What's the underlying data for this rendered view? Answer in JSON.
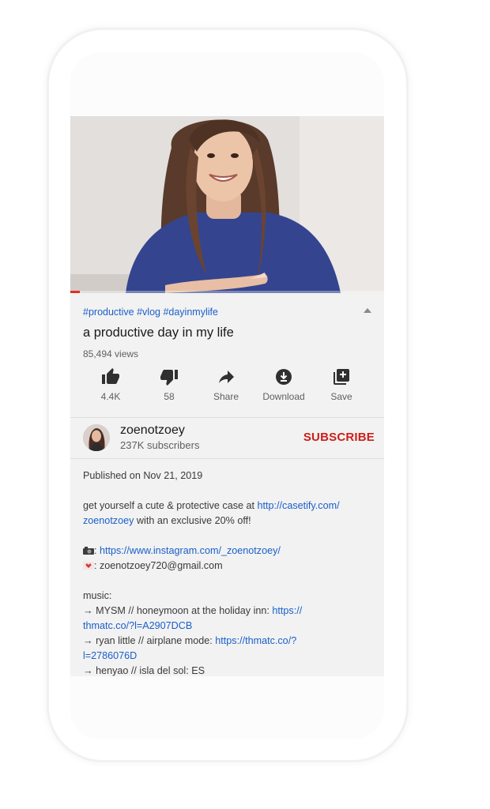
{
  "video": {
    "progress_fraction": 0.03,
    "hashtags": "#productive #vlog #dayinmylife",
    "title": "a productive day in my life",
    "views": "85,494 views"
  },
  "actions": [
    {
      "label": "4.4K",
      "icon": "thumbs-up-icon"
    },
    {
      "label": "58",
      "icon": "thumbs-down-icon"
    },
    {
      "label": "Share",
      "icon": "share-icon"
    },
    {
      "label": "Download",
      "icon": "download-icon"
    },
    {
      "label": "Save",
      "icon": "save-playlist-icon"
    }
  ],
  "channel": {
    "name": "zoenotzoey",
    "subscribers": "237K subscribers",
    "subscribe_label": "SUBSCRIBE"
  },
  "description": {
    "published": "Published on Nov 21, 2019",
    "promo_text_1": "get yourself a cute & protective case at ",
    "promo_link": "http://casetify.com/zoenotzoey",
    "promo_link_part1": "http://casetify.com/",
    "promo_link_part2": "zoenotzoey",
    "promo_text_2": " with an exclusive 20% off!",
    "instagram_link": "https://www.instagram.com/_zoenotzoey/",
    "email_text": ": zoenotzoey720@gmail.com",
    "music_label": "music:",
    "track1_text": "→  MYSM // honeymoon at the holiday inn: ",
    "track1_link_a": "https://",
    "track1_link_b": "thmatc.co/?l=A2907DCB",
    "track2_text": "→  ryan little // airplane mode: ",
    "track2_link_a": "https://thmatc.co/?",
    "track2_link_b": "l=2786076D",
    "track3_text": "→ henyao // isla del sol: ES"
  },
  "colors": {
    "link": "#1a5fc9",
    "subscribe": "#cc1f1a",
    "progress": "#e52d27"
  }
}
